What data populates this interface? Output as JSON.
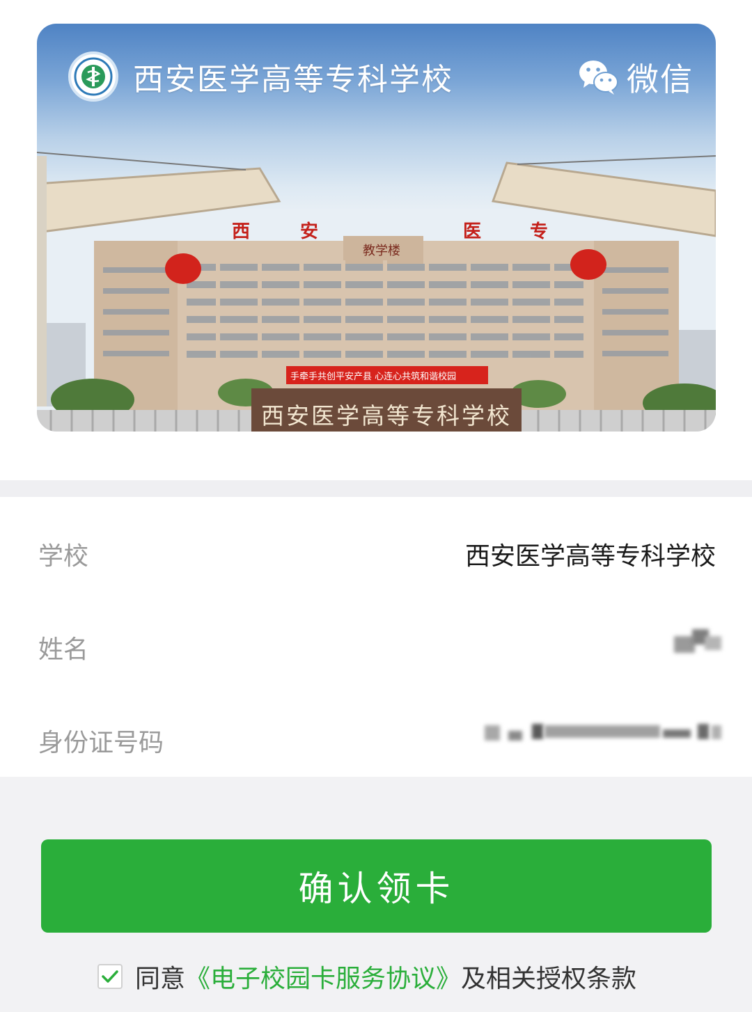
{
  "card": {
    "title": "西安医学高等专科学校",
    "brand_label": "微信",
    "banner_sign_chars": [
      "西",
      "安",
      "医",
      "专"
    ],
    "building_sign": "教学楼",
    "banner_slogan": "手牵手共创平安产县  心连心共筑和谐校园",
    "gate_stone_text": "西安医学高等专科学校"
  },
  "form": {
    "school_label": "学校",
    "school_value": "西安医学高等专科学校",
    "name_label": "姓名",
    "id_label": "身份证号码"
  },
  "actions": {
    "confirm_label": "确认领卡",
    "agree_prefix": "同意",
    "agree_link": "《电子校园卡服务协议》",
    "agree_suffix": "及相关授权条款",
    "agree_checked": true
  },
  "colors": {
    "accent_green": "#2aae3a",
    "label_gray": "#9a9a9a"
  },
  "icons": {
    "school_logo": "school-emblem-icon",
    "wechat": "wechat-icon",
    "check": "checkmark-icon"
  }
}
